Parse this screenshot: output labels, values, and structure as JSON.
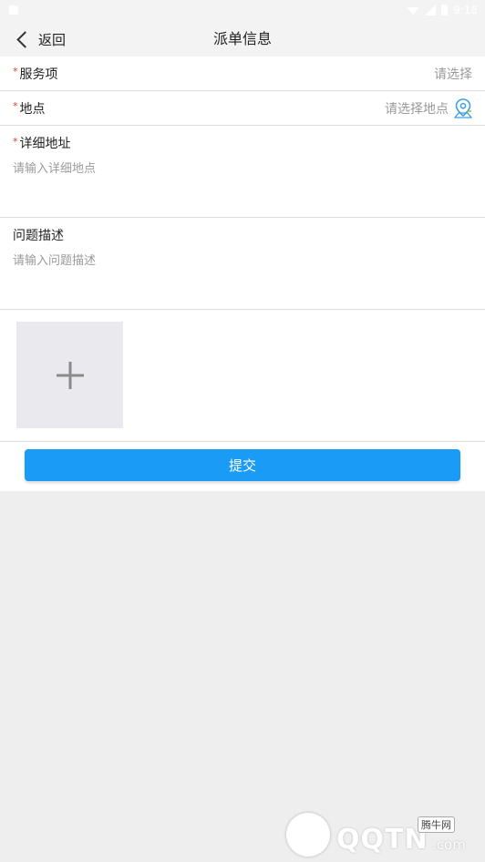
{
  "status_bar": {
    "time": "9:18"
  },
  "nav": {
    "back_label": "返回",
    "title": "派单信息"
  },
  "form": {
    "service": {
      "label": "服务项",
      "required_mark": "*",
      "placeholder": "请选择"
    },
    "location": {
      "label": "地点",
      "required_mark": "*",
      "placeholder": "请选择地点",
      "icon": "map-pin-icon"
    },
    "address": {
      "label": "详细地址",
      "required_mark": "*",
      "placeholder": "请输入详细地点"
    },
    "description": {
      "label": "问题描述",
      "placeholder": "请输入问题描述"
    },
    "photo": {
      "icon": "plus-icon"
    }
  },
  "submit_label": "提交",
  "colors": {
    "accent": "#1a9bf6",
    "required": "#e0402a",
    "placeholder": "#9a9a9a"
  },
  "watermark": {
    "brand": "QQTN",
    "domain_suffix": ".com",
    "cn_name": "腾牛网"
  }
}
